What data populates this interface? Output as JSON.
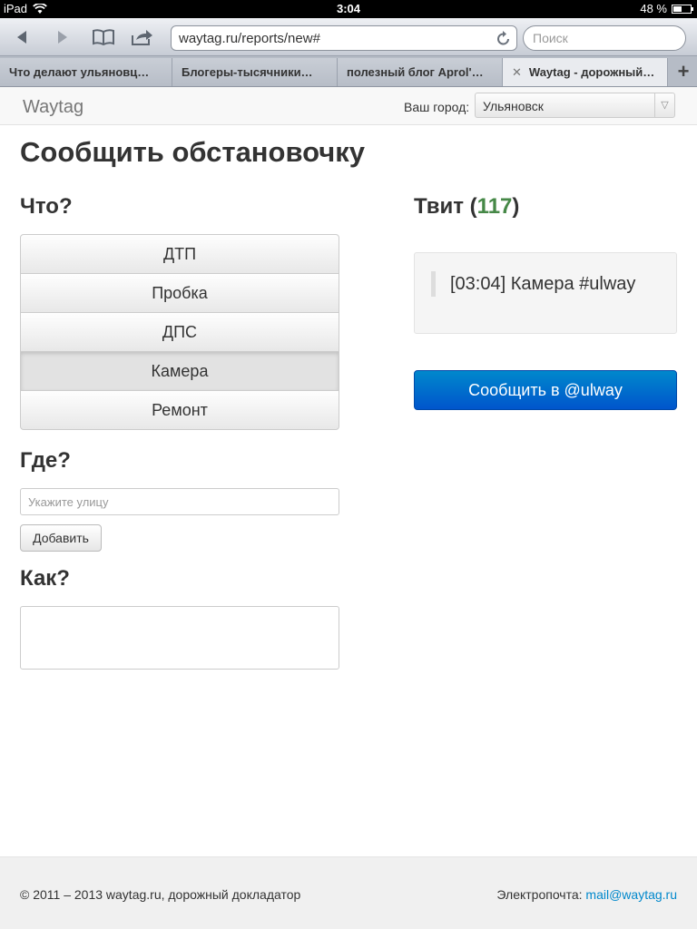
{
  "status_bar": {
    "device": "iPad",
    "time": "3:04",
    "battery": "48 %",
    "battery_level": 0.48
  },
  "browser": {
    "url": "waytag.ru/reports/new#",
    "search_placeholder": "Поиск",
    "tabs": [
      {
        "label": "Что делают ульяновц…"
      },
      {
        "label": "Блогеры-тысячники…"
      },
      {
        "label": "полезный блог Aprol'…"
      },
      {
        "label": "Waytag - дорожный…",
        "active": true
      }
    ]
  },
  "navbar": {
    "brand": "Waytag",
    "city_label": "Ваш город:",
    "city_value": "Ульяновск"
  },
  "page": {
    "title": "Сообщить обстановочку",
    "what_heading": "Что?",
    "options": [
      {
        "label": "ДТП"
      },
      {
        "label": "Пробка"
      },
      {
        "label": "ДПС"
      },
      {
        "label": "Камера",
        "selected": true
      },
      {
        "label": "Ремонт"
      }
    ],
    "where_heading": "Где?",
    "street_placeholder": "Укажите улицу",
    "add_label": "Добавить",
    "how_heading": "Как?",
    "tweet_heading": "Твит (",
    "tweet_count": "117",
    "tweet_heading_close": ")",
    "tweet_text": "[03:04] Камера #ulway",
    "report_label": "Сообщить в @ulway"
  },
  "footer": {
    "copyright": "© 2011 – 2013 waytag.ru, дорожный докладатор",
    "email_label": "Электропочта:",
    "email": "mail@waytag.ru"
  },
  "colors": {
    "accent": "#0088cc",
    "counter": "#468847"
  }
}
